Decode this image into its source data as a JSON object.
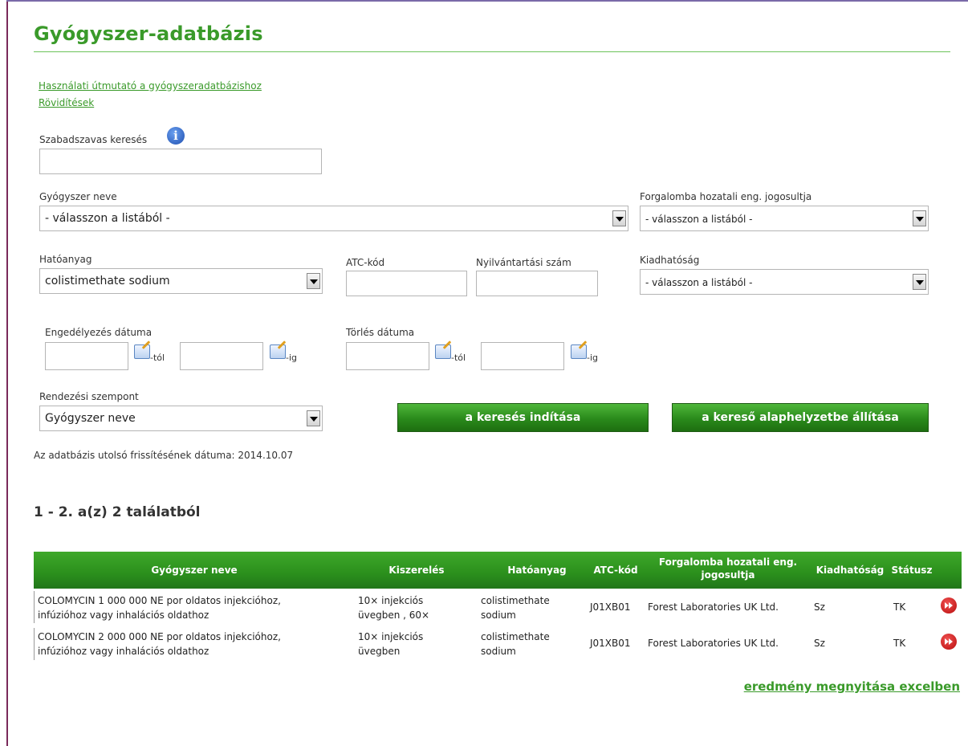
{
  "page_title": "Gyógyszer-adatbázis",
  "links": {
    "guide": "Használati útmutató a gyógyszeradatbázishoz",
    "abbreviations": "Rövidítések"
  },
  "search": {
    "freetext_label": "Szabadszavas keresés",
    "freetext_value": "",
    "drug_name_label": "Gyógyszer neve",
    "drug_name_value": "- válasszon a listából -",
    "holder_label": "Forgalomba hozatali eng. jogosultja",
    "holder_value": "- válasszon a listából -",
    "active_label": "Hatóanyag",
    "active_value": "colistimethate sodium",
    "atc_label": "ATC-kód",
    "atc_value": "",
    "reg_label": "Nyilvántartási szám",
    "reg_value": "",
    "dispense_label": "Kiadhatóság",
    "dispense_value": "- válasszon a listából -",
    "approval_date_label": "Engedélyezés dátuma",
    "delete_date_label": "Törlés dátuma",
    "from_suffix": "-tól",
    "to_suffix": "-ig",
    "sort_label": "Rendezési szempont",
    "sort_value": "Gyógyszer neve",
    "search_button": "a keresés indítása",
    "reset_button": "a kereső alaphelyzetbe állítása",
    "last_update": "Az adatbázis utolsó frissítésének dátuma: 2014.10.07"
  },
  "results": {
    "summary": "1 - 2. a(z) 2 találatból",
    "headers": {
      "name": "Gyógyszer neve",
      "pack": "Kiszerelés",
      "active": "Hatóanyag",
      "atc": "ATC-kód",
      "holder_line1": "Forgalomba hozatali eng.",
      "holder_line2": "jogosultja",
      "dispense": "Kiadhatóság",
      "status": "Státusz"
    },
    "rows": [
      {
        "name_line1": "COLOMYCIN 1 000 000 NE por oldatos injekcióhoz,",
        "name_line2": "infúzióhoz vagy inhalációs oldathoz",
        "pack_line1": "10× injekciós",
        "pack_line2": "üvegben  , 60×",
        "active_line1": "colistimethate",
        "active_line2": "sodium",
        "atc": "J01XB01",
        "holder": "Forest Laboratories UK Ltd.",
        "dispense": "Sz",
        "status": "TK"
      },
      {
        "name_line1": "COLOMYCIN 2 000 000 NE por oldatos injekcióhoz,",
        "name_line2": "infúzióhoz vagy inhalációs oldathoz",
        "pack_line1": "10× injekciós",
        "pack_line2": "üvegben",
        "active_line1": "colistimethate",
        "active_line2": "sodium",
        "atc": "J01XB01",
        "holder": "Forest Laboratories UK Ltd.",
        "dispense": "Sz",
        "status": "TK"
      }
    ],
    "excel_link": "eredmény megnyitása excelben"
  }
}
